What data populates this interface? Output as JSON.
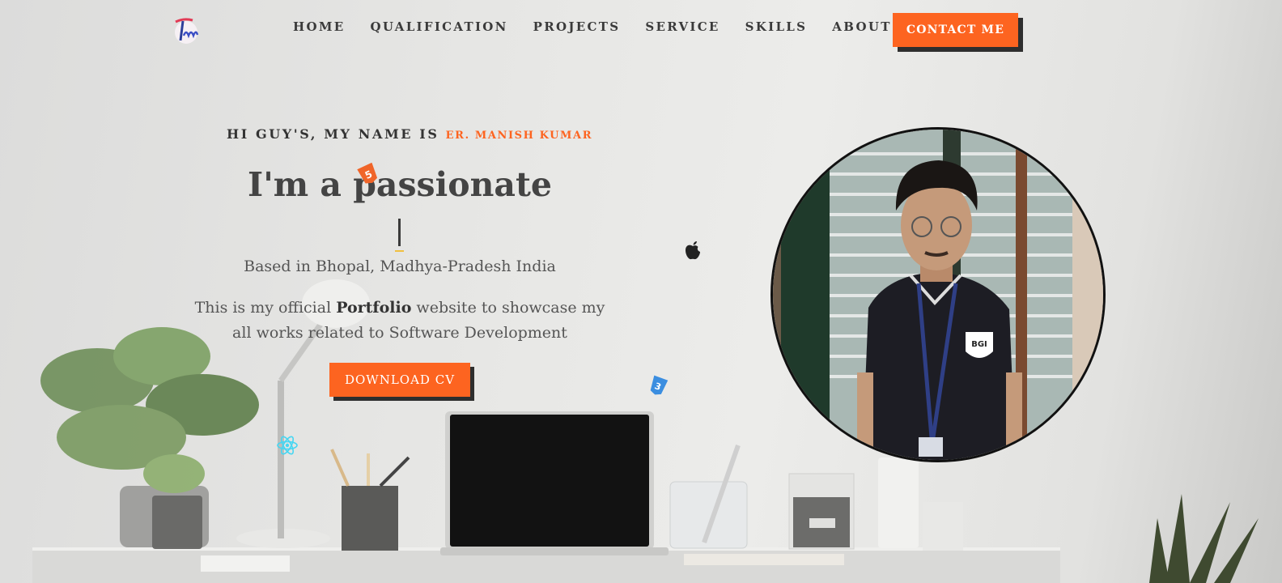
{
  "nav": {
    "items": [
      "HOME",
      "QUALIFICATION",
      "PROJECTS",
      "SERVICE",
      "SKILLS",
      "ABOUT US"
    ],
    "contact_label": "CONTACT ME"
  },
  "hero": {
    "greeting": "HI GUY'S, MY NAME IS",
    "name": "ER. MANISH KUMAR",
    "headline": "I'm a passionate",
    "location": "Based in Bhopal, Madhya-Pradesh India",
    "desc_before": "This is my official ",
    "desc_bold": "Portfolio",
    "desc_after": " website to showcase my all works related to Software Development",
    "cv_label": "DOWNLOAD CV"
  },
  "icons": [
    "logo-icon",
    "html5-icon",
    "apple-icon",
    "css3-icon",
    "react-icon"
  ],
  "colors": {
    "accent": "#fd6420",
    "dark": "#2e2e2e",
    "text": "#444444"
  }
}
